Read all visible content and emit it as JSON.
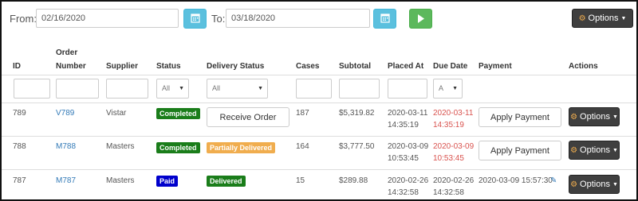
{
  "filters": {
    "from_label": "From:",
    "from_value": "02/16/2020",
    "to_label": "To:",
    "to_value": "03/18/2020",
    "options_label": "Options"
  },
  "columns": {
    "id": "ID",
    "order_number_line1": "Order",
    "order_number_line2": "Number",
    "supplier": "Supplier",
    "status": "Status",
    "delivery_status": "Delivery Status",
    "cases": "Cases",
    "subtotal": "Subtotal",
    "placed_at": "Placed At",
    "due_date": "Due Date",
    "payment": "Payment",
    "actions": "Actions"
  },
  "column_filters": {
    "status_select": "All",
    "delivery_status_select": "All",
    "due_date_select": "A"
  },
  "rows": [
    {
      "id": "789",
      "order_number": "V789",
      "supplier": "Vistar",
      "status": "Completed",
      "delivery_action": "Receive Order",
      "cases": "187",
      "subtotal": "$5,319.82",
      "placed_date": "2020-03-11",
      "placed_time": "14:35:19",
      "due_date": "2020-03-11",
      "due_time": "14:35:19",
      "payment_action": "Apply Payment",
      "actions_label": "Options"
    },
    {
      "id": "788",
      "order_number": "M788",
      "supplier": "Masters",
      "status": "Completed",
      "delivery_status": "Partially Delivered",
      "cases": "164",
      "subtotal": "$3,777.50",
      "placed_date": "2020-03-09",
      "placed_time": "10:53:45",
      "due_date": "2020-03-09",
      "due_time": "10:53:45",
      "payment_action": "Apply Payment",
      "actions_label": "Options"
    },
    {
      "id": "787",
      "order_number": "M787",
      "supplier": "Masters",
      "status": "Paid",
      "delivery_status": "Delivered",
      "cases": "15",
      "subtotal": "$289.88",
      "placed_date": "2020-02-26",
      "placed_time": "14:32:58",
      "due_date": "2020-02-26",
      "due_time": "14:32:58",
      "payment_value": "2020-03-09 15:57:30",
      "actions_label": "Options"
    }
  ],
  "colors": {
    "completed": "#1a7d1a",
    "paid": "#0000cc",
    "partially_delivered": "#f0ad4e",
    "delivered": "#1a7d1a",
    "overdue": "#d9534f",
    "link": "#337ab7"
  },
  "icons": {
    "calendar": "calendar-icon",
    "play": "play-icon",
    "options": "gear-icon",
    "edit": "pencil-icon"
  }
}
